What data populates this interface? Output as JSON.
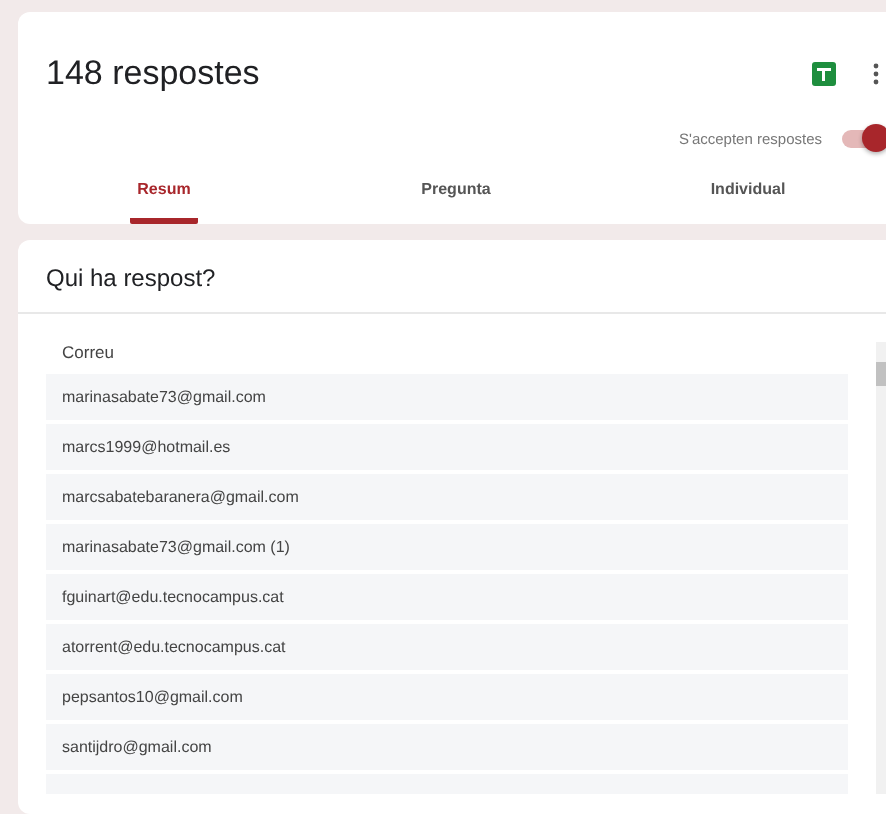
{
  "header": {
    "title": "148 respostes",
    "accepting": {
      "label": "S'accepten respostes",
      "on": true
    }
  },
  "tabs": [
    {
      "label": "Resum",
      "selected": true
    },
    {
      "label": "Pregunta",
      "selected": false
    },
    {
      "label": "Individual",
      "selected": false
    }
  ],
  "section": {
    "title": "Qui ha respost?",
    "column": "Correu",
    "rows": [
      "marinasabate73@gmail.com",
      "marcs1999@hotmail.es",
      "marcsabatebaranera@gmail.com",
      "marinasabate73@gmail.com (1)",
      "fguinart@edu.tecnocampus.cat",
      "atorrent@edu.tecnocampus.cat",
      "pepsantos10@gmail.com",
      "santijdro@gmail.com"
    ]
  }
}
